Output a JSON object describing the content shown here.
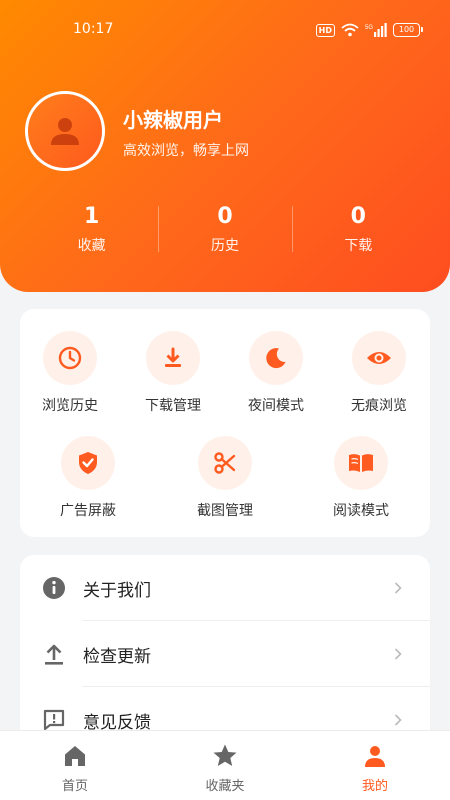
{
  "status_bar": {
    "time": "10:17",
    "network": "5G",
    "battery": "100"
  },
  "profile": {
    "name": "小辣椒用户",
    "slogan": "高效浏览，畅享上网"
  },
  "stats": [
    {
      "value": "1",
      "label": "收藏"
    },
    {
      "value": "0",
      "label": "历史"
    },
    {
      "value": "0",
      "label": "下载"
    }
  ],
  "tools": [
    {
      "label": "浏览历史",
      "icon": "clock-icon"
    },
    {
      "label": "下载管理",
      "icon": "download-icon"
    },
    {
      "label": "夜间模式",
      "icon": "moon-icon"
    },
    {
      "label": "无痕浏览",
      "icon": "eye-icon"
    },
    {
      "label": "广告屏蔽",
      "icon": "shield-check-icon"
    },
    {
      "label": "截图管理",
      "icon": "scissors-icon"
    },
    {
      "label": "阅读模式",
      "icon": "book-icon"
    }
  ],
  "menu": [
    {
      "label": "关于我们",
      "icon": "info-icon"
    },
    {
      "label": "检查更新",
      "icon": "upload-icon"
    },
    {
      "label": "意见反馈",
      "icon": "feedback-icon"
    }
  ],
  "tabs": [
    {
      "label": "首页",
      "icon": "home-icon"
    },
    {
      "label": "收藏夹",
      "icon": "star-icon"
    },
    {
      "label": "我的",
      "icon": "person-icon"
    }
  ],
  "colors": {
    "accent": "#ff5a1f",
    "icon_bg": "#fff1ea",
    "menu_icon": "#555555"
  }
}
